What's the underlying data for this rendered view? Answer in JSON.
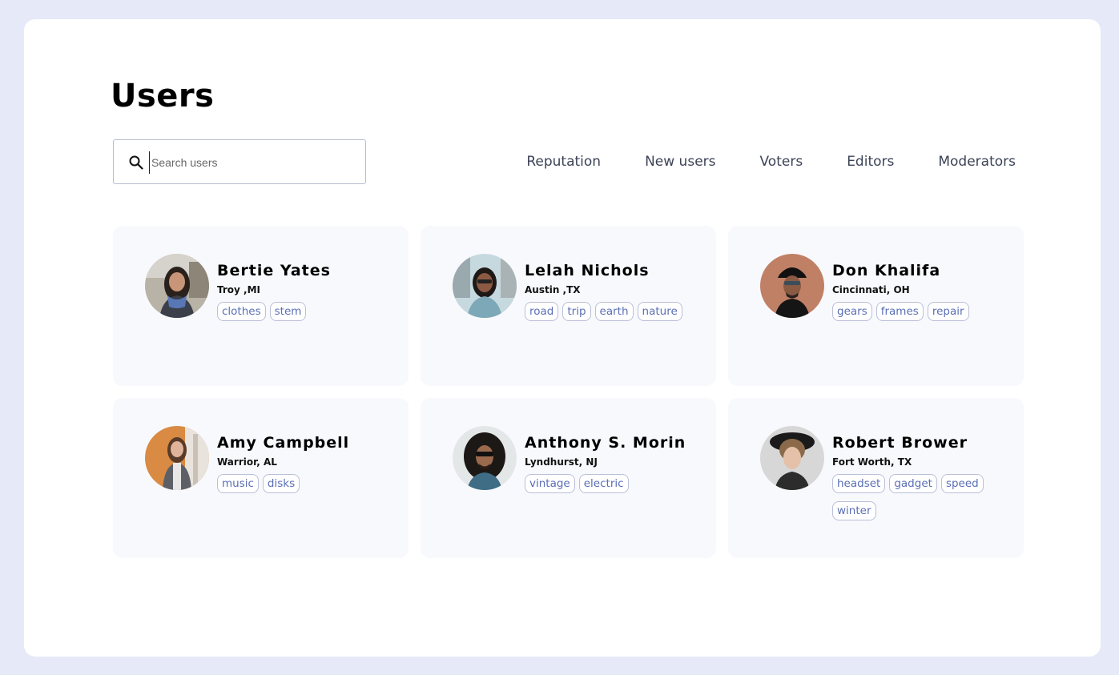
{
  "page": {
    "title": "Users"
  },
  "search": {
    "placeholder": "Search users",
    "value": ""
  },
  "tabs": [
    {
      "label": "Reputation"
    },
    {
      "label": "New users"
    },
    {
      "label": "Voters"
    },
    {
      "label": "Editors"
    },
    {
      "label": "Moderators"
    }
  ],
  "users": [
    {
      "name": "Bertie Yates",
      "location": "Troy ,MI",
      "tags": [
        "clothes",
        "stem"
      ]
    },
    {
      "name": "Lelah Nichols",
      "location": "Austin ,TX",
      "tags": [
        "road",
        "trip",
        "earth",
        "nature"
      ]
    },
    {
      "name": "Don Khalifa",
      "location": "Cincinnati, OH",
      "tags": [
        "gears",
        "frames",
        "repair"
      ]
    },
    {
      "name": "Amy Campbell",
      "location": "Warrior, AL",
      "tags": [
        "music",
        "disks"
      ]
    },
    {
      "name": "Anthony S. Morin",
      "location": "Lyndhurst, NJ",
      "tags": [
        "vintage",
        "electric"
      ]
    },
    {
      "name": "Robert Brower",
      "location": "Fort Worth, TX",
      "tags": [
        "headset",
        "gadget",
        "speed",
        "winter"
      ]
    }
  ],
  "colors": {
    "background": "#e6e9f7",
    "panel": "#ffffff",
    "card": "#f8f9fd",
    "tag_text": "#5a6fb5",
    "tag_border": "#b9bfd8",
    "tab_text": "#3c4357"
  },
  "icons": {
    "search": "search-icon"
  }
}
